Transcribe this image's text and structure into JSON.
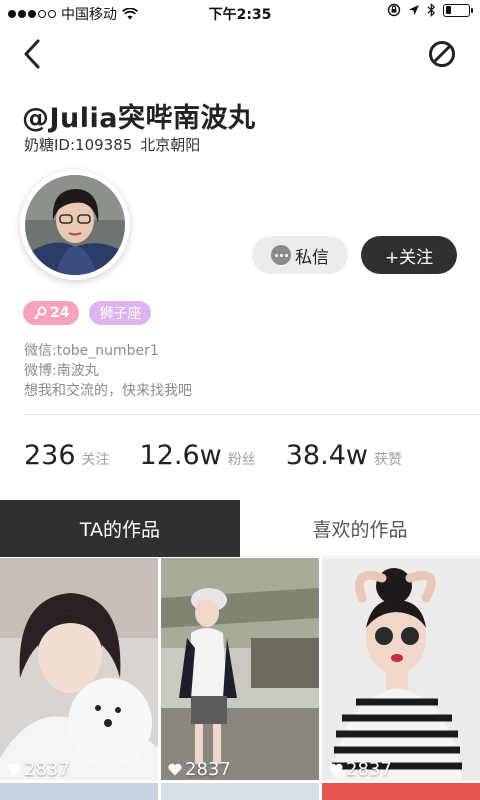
{
  "status_bar": {
    "carrier": "中国移动",
    "time": "下午2:35",
    "battery_level": 0.25
  },
  "nav": {
    "back_icon": "chevron-left-icon",
    "block_icon": "block-icon"
  },
  "profile": {
    "username": "@Julia突哔南波丸",
    "id_text": "奶糖ID:109385",
    "location": "北京朝阳",
    "message_label": "私信",
    "follow_label": "+关注",
    "level": "24",
    "zodiac": "狮子座",
    "bio_lines": [
      "微信:tobe_number1",
      "微博:南波丸",
      "想我和交流的，快来找我吧"
    ]
  },
  "stats": [
    {
      "value": "236",
      "label": "关注"
    },
    {
      "value": "12.6w",
      "label": "粉丝"
    },
    {
      "value": "38.4w",
      "label": "获赞"
    }
  ],
  "tabs": [
    {
      "label": "TA的作品",
      "active": true
    },
    {
      "label": "喜欢的作品",
      "active": false
    }
  ],
  "works": [
    {
      "likes": "2837"
    },
    {
      "likes": "2837"
    },
    {
      "likes": "2837"
    }
  ],
  "colors": {
    "dark": "#303030",
    "level_badge": "#f5a3b9",
    "zodiac_badge": "#dcb4f0",
    "muted": "#8c8c8c"
  }
}
